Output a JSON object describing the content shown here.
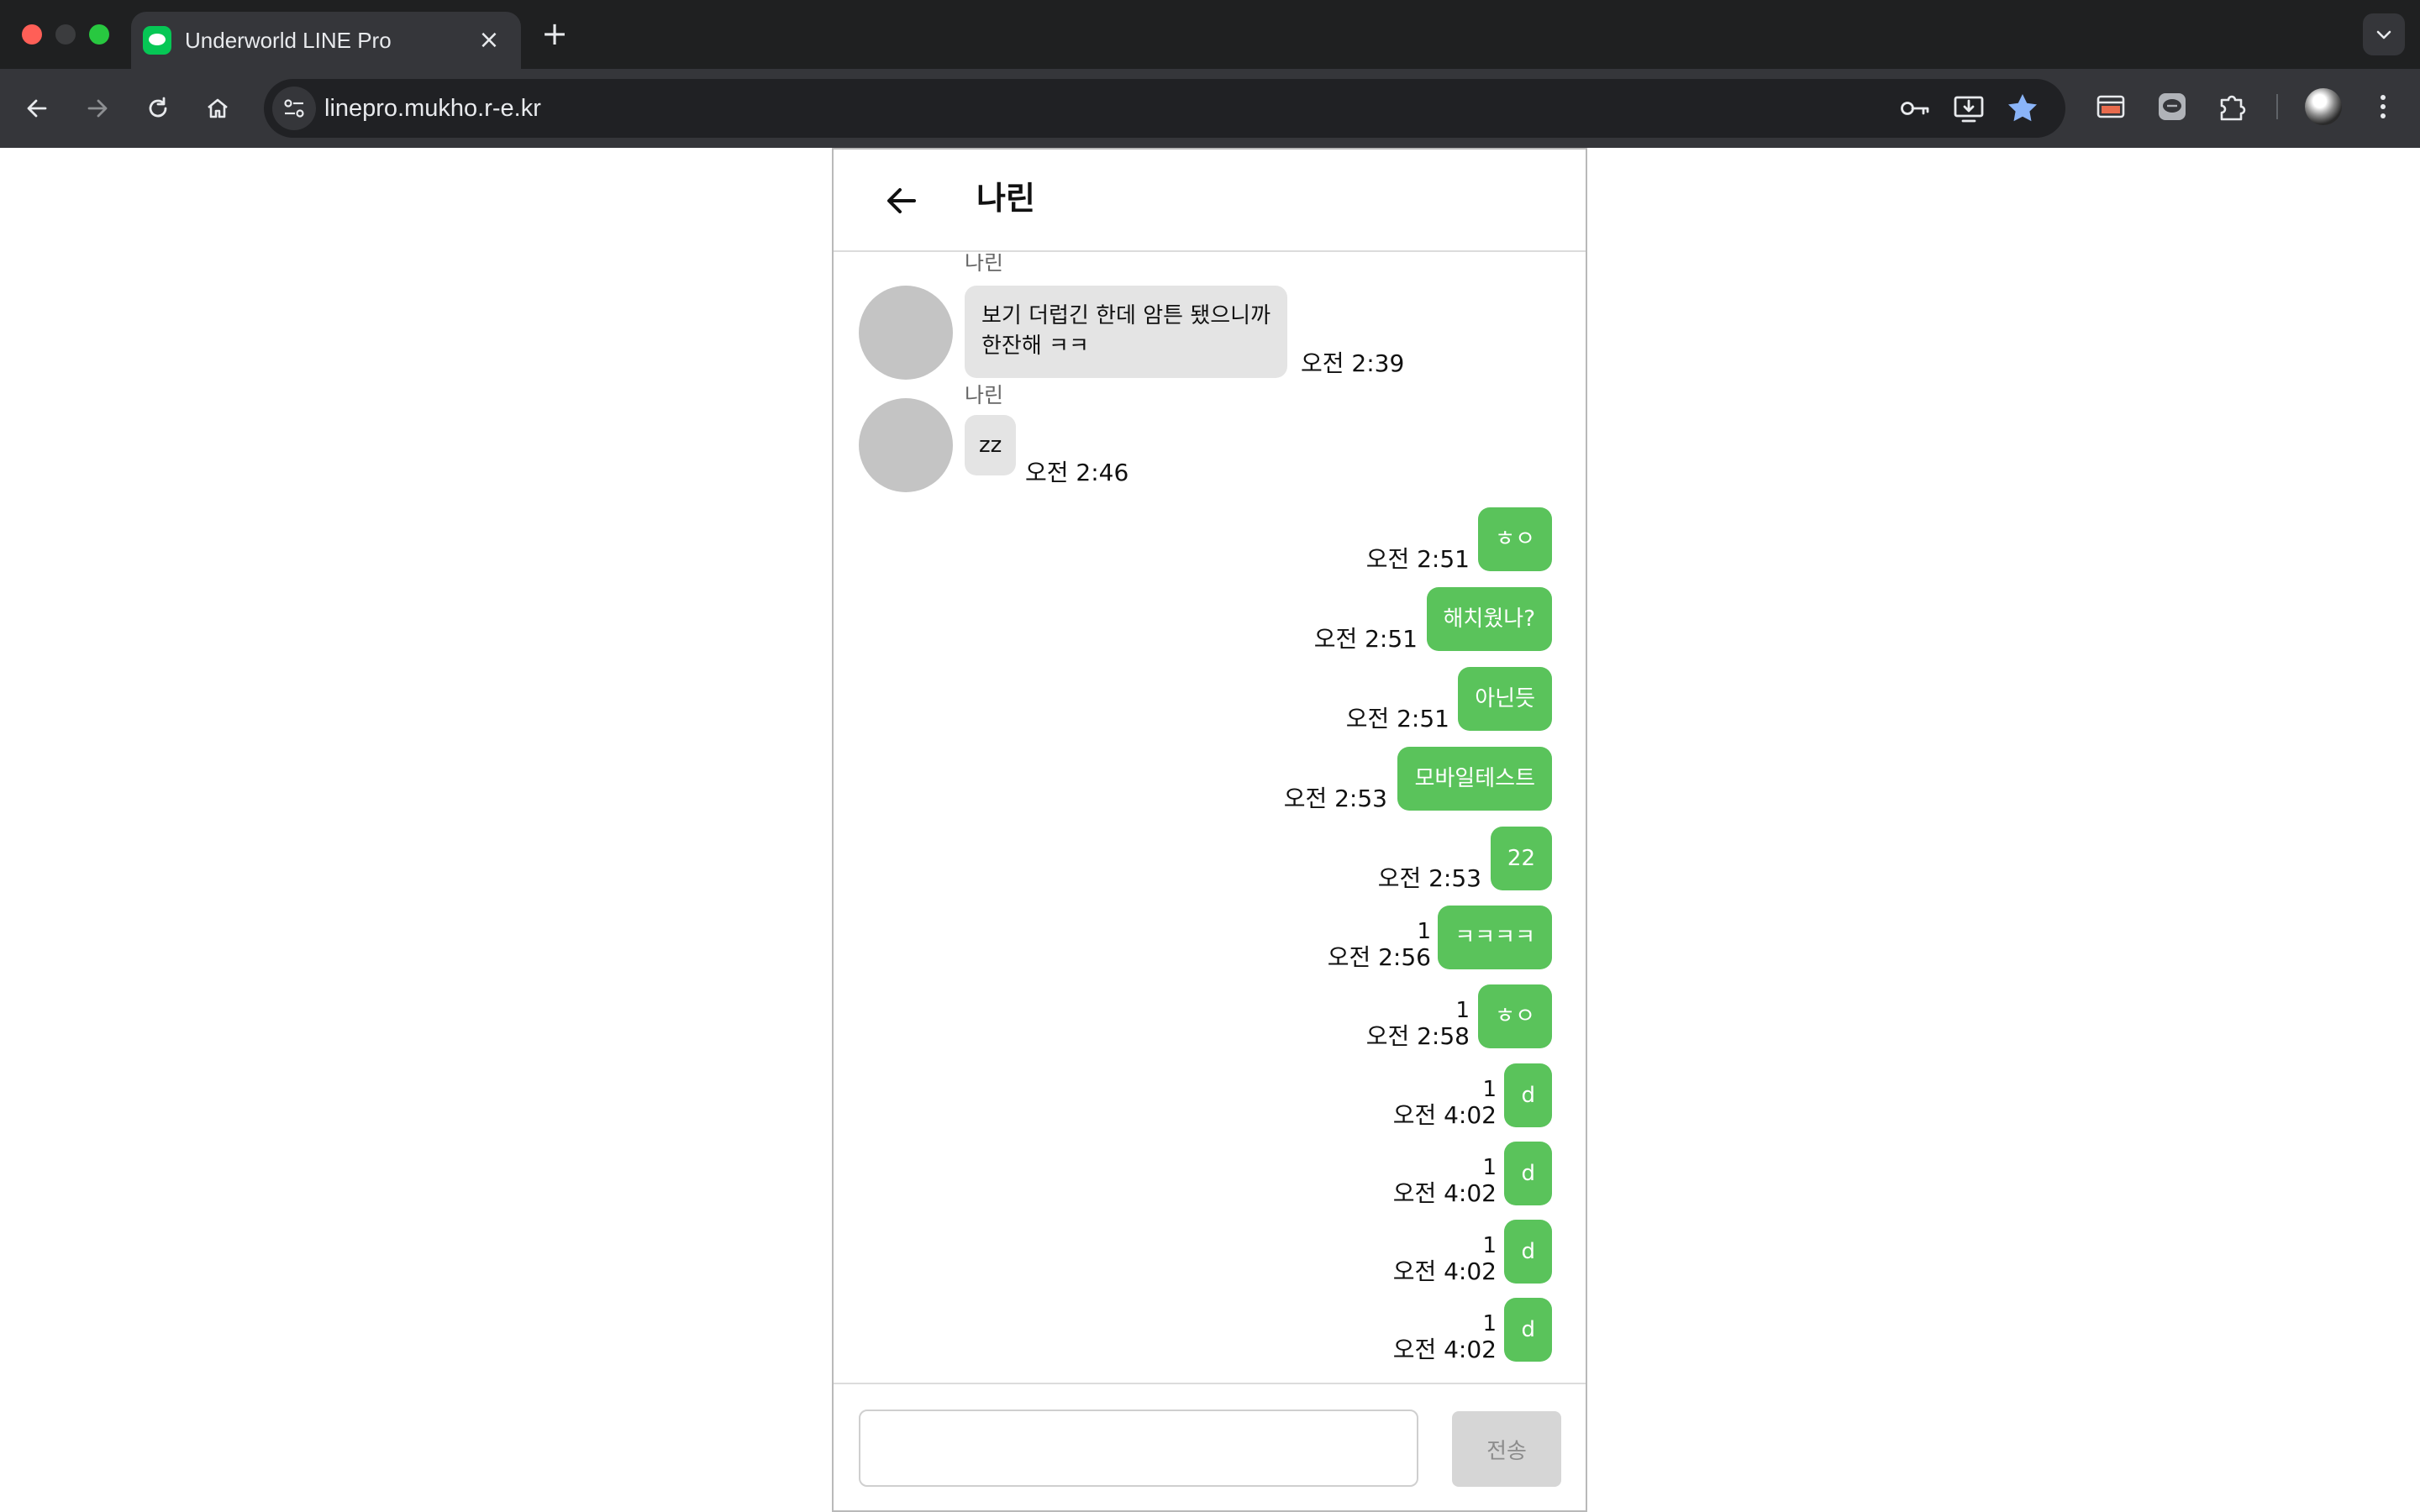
{
  "browser": {
    "tab_title": "Underworld LINE Pro",
    "tab_close": "×",
    "new_tab": "+",
    "url": "linepro.mukho.r-e.kr"
  },
  "chat": {
    "title": "나린",
    "incoming": [
      {
        "sender": "나린",
        "lines": [
          "보기 더럽긴 한데 암튼 됐으니까",
          "한잔해 ㅋㅋ"
        ],
        "time": "오전 2:39"
      },
      {
        "sender": "나린",
        "lines": [
          "zz"
        ],
        "time": "오전 2:46"
      }
    ],
    "outgoing": [
      {
        "text": "ㅎㅇ",
        "read": "",
        "time": "오전 2:51"
      },
      {
        "text": "해치웠나?",
        "read": "",
        "time": "오전 2:51"
      },
      {
        "text": "아닌듯",
        "read": "",
        "time": "오전 2:51"
      },
      {
        "text": "모바일테스트",
        "read": "",
        "time": "오전 2:53"
      },
      {
        "text": "22",
        "read": "",
        "time": "오전 2:53"
      },
      {
        "text": "ㅋㅋㅋㅋ",
        "read": "1",
        "time": "오전 2:56"
      },
      {
        "text": "ㅎㅇ",
        "read": "1",
        "time": "오전 2:58"
      },
      {
        "text": "d",
        "read": "1",
        "time": "오전 4:02"
      },
      {
        "text": "d",
        "read": "1",
        "time": "오전 4:02"
      },
      {
        "text": "d",
        "read": "1",
        "time": "오전 4:02"
      },
      {
        "text": "d",
        "read": "1",
        "time": "오전 4:02"
      }
    ]
  },
  "composer": {
    "value": "",
    "send_label": "전송"
  }
}
